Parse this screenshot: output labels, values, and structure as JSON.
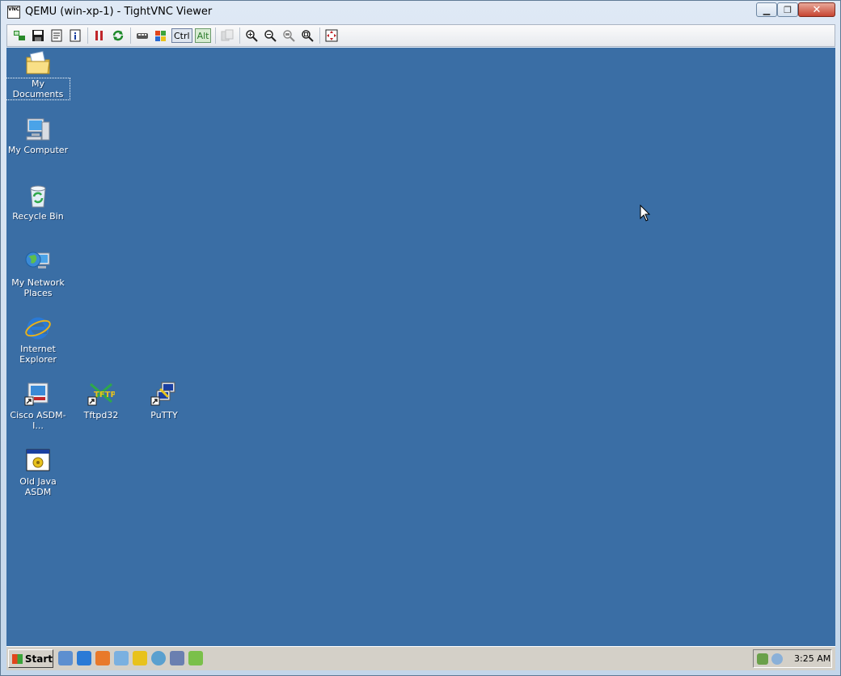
{
  "window": {
    "title": "QEMU (win-xp-1) - TightVNC Viewer",
    "icon_text": "VNC",
    "minimize_glyph": "▁",
    "maximize_glyph": "❐",
    "close_glyph": "✕"
  },
  "toolbar": {
    "ctrl_label": "Ctrl",
    "alt_label": "Alt"
  },
  "desktop": {
    "background": "#3a6ea5",
    "icons": [
      {
        "label": "My Documents"
      },
      {
        "label": "My Computer"
      },
      {
        "label": "Recycle Bin"
      },
      {
        "label": "My Network Places"
      },
      {
        "label": "Internet Explorer"
      },
      {
        "label": "Cisco ASDM-I..."
      },
      {
        "label": "Tftpd32"
      },
      {
        "label": "PuTTY"
      },
      {
        "label": "Old Java ASDM"
      }
    ]
  },
  "taskbar": {
    "start_label": "Start",
    "clock": "3:25 AM"
  }
}
